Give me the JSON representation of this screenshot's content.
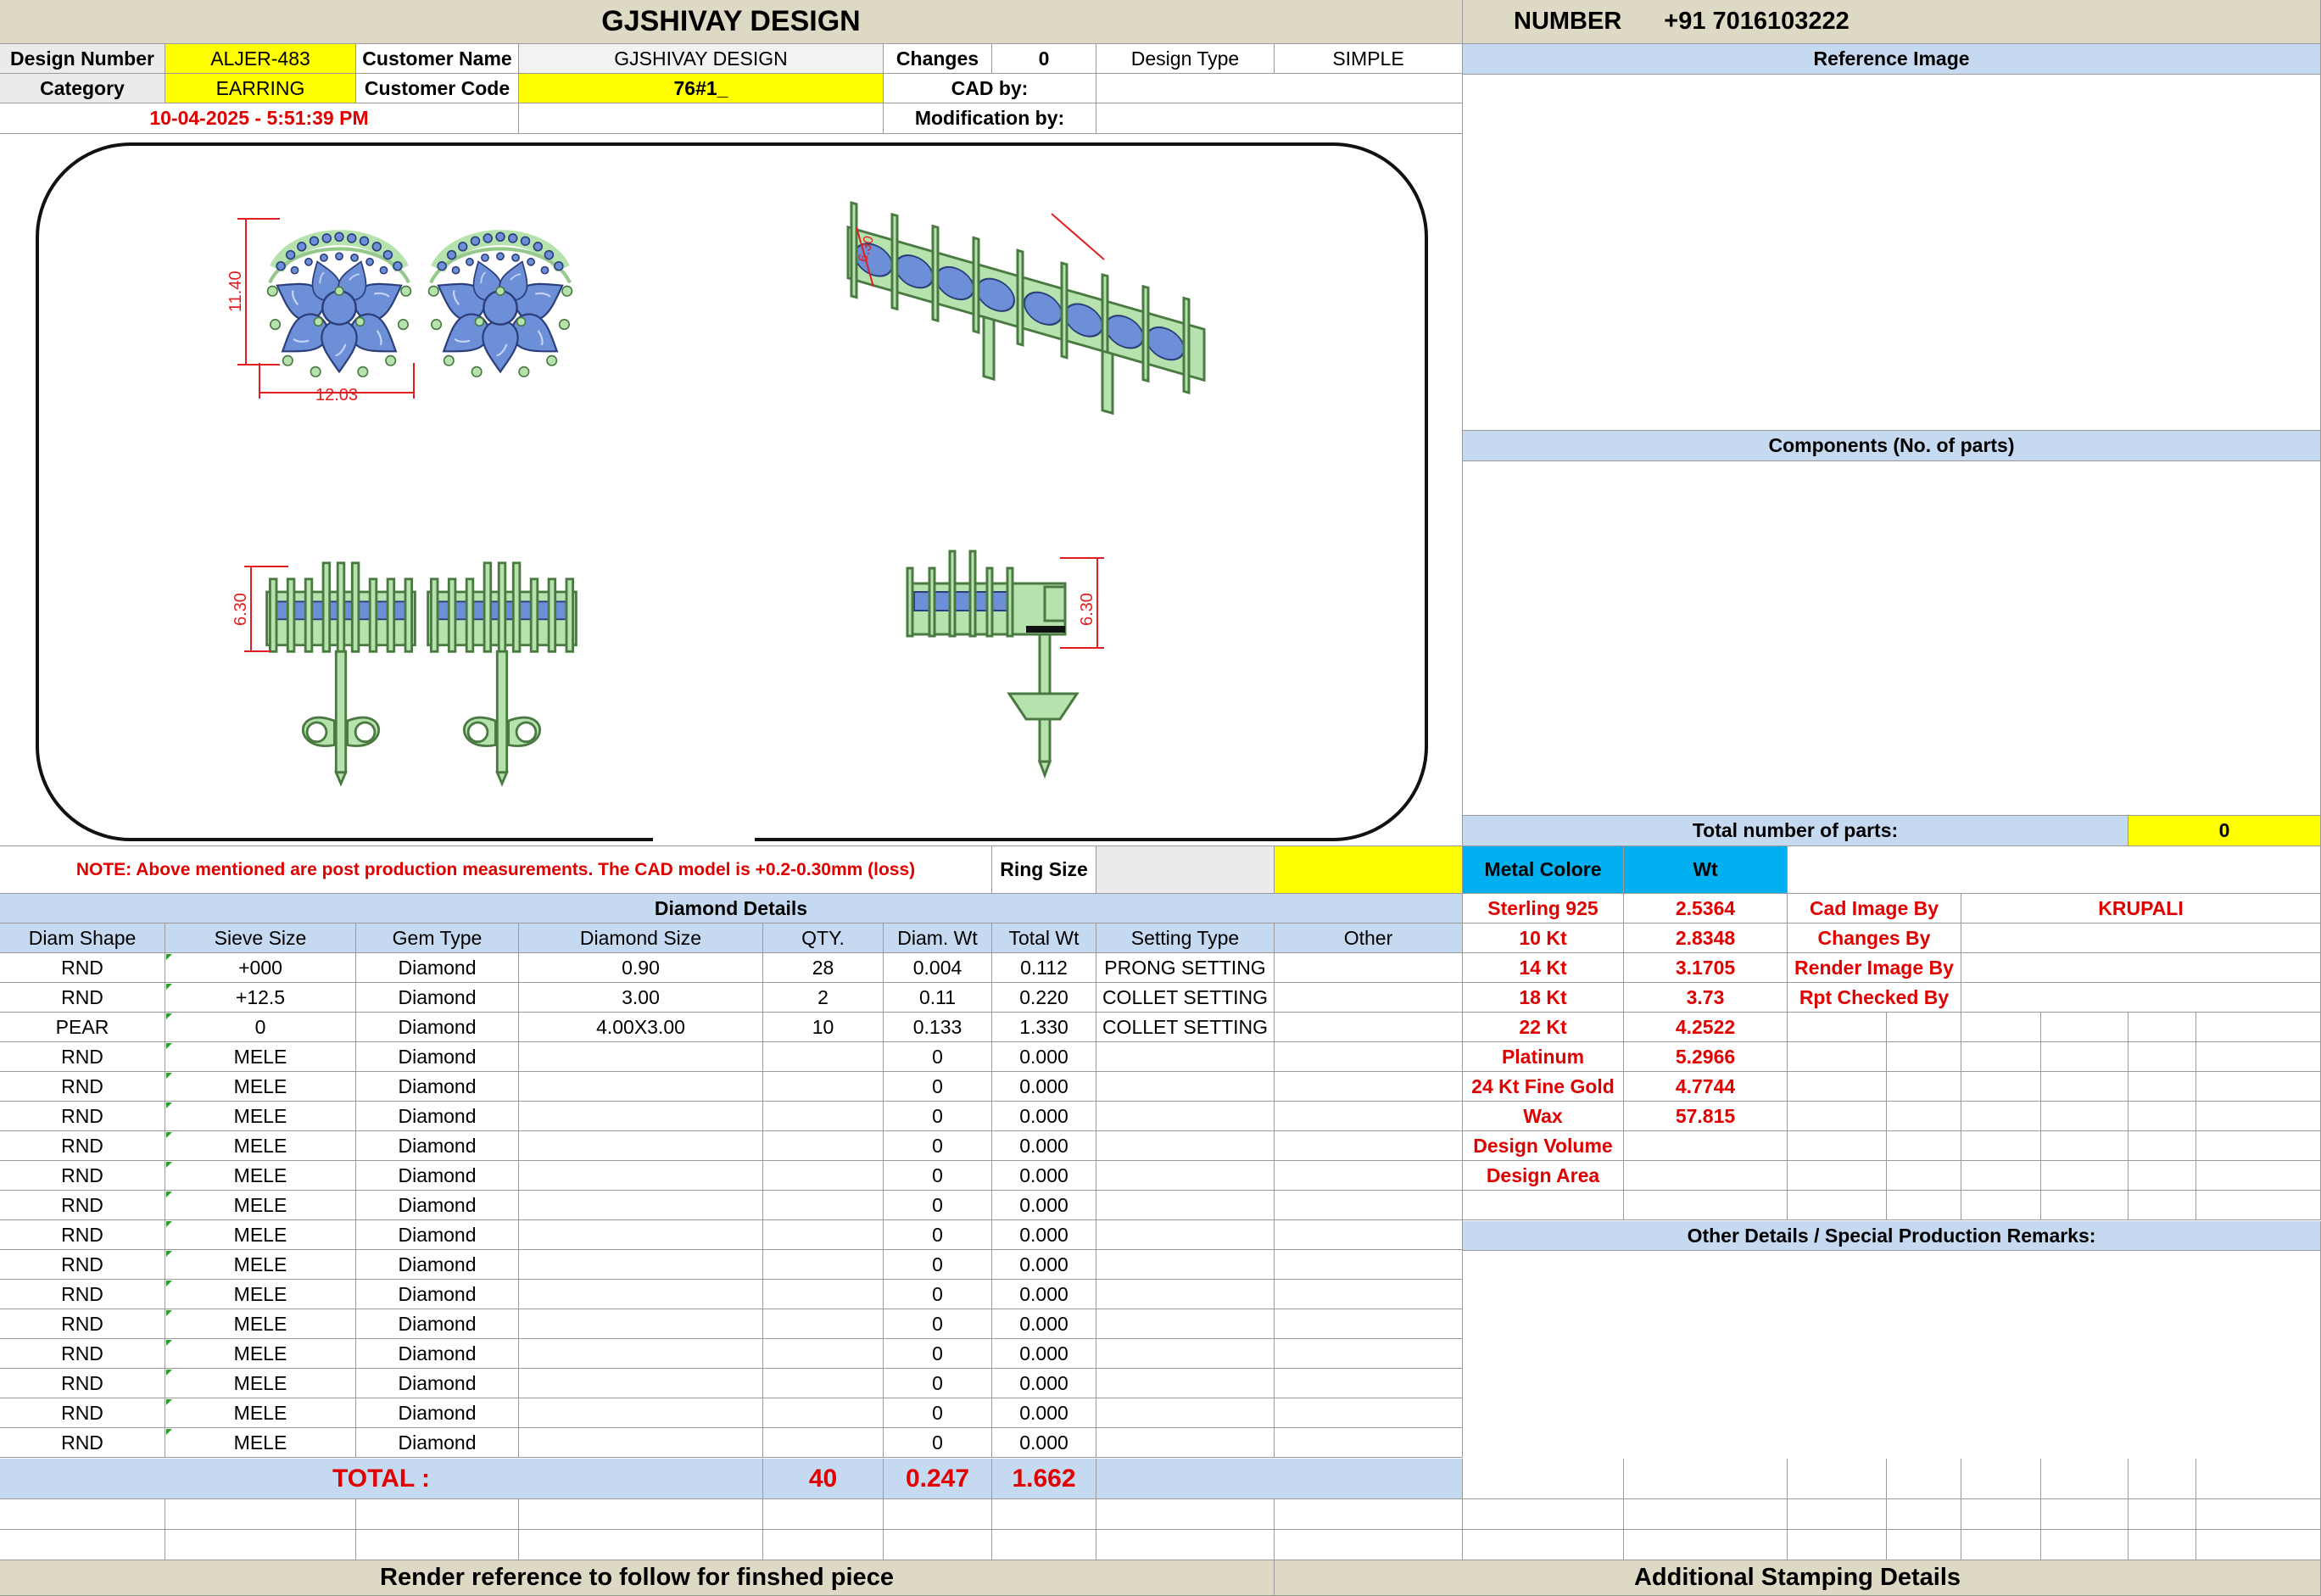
{
  "header": {
    "title": "GJSHIVAY DESIGN",
    "number_label": "NUMBER",
    "number_value": "+91 7016103222"
  },
  "info": {
    "design_number_label": "Design Number",
    "design_number": "ALJER-483",
    "customer_name_label": "Customer Name",
    "customer_name": "GJSHIVAY DESIGN",
    "changes_label": "Changes",
    "changes": "0",
    "design_type_label": "Design Type",
    "design_type": "SIMPLE",
    "category_label": "Category",
    "category": "EARRING",
    "customer_code_label": "Customer Code",
    "customer_code": "76#1_",
    "cad_by_label": "CAD by:",
    "cad_by": "",
    "datetime": "10-04-2025 - 5:51:39 PM",
    "modification_by_label": "Modification by:",
    "modification_by": ""
  },
  "drawing": {
    "dim_front_height": "11.40",
    "dim_front_width": "12.03",
    "dim_iso_small": "6.30",
    "dim_side_height": "6.30",
    "dim_profile_height": "6.30",
    "colors": {
      "metal": "#b6e3ad",
      "stone": "#6d8fd8",
      "dimension": "#e02020"
    }
  },
  "right_panel": {
    "reference_image_title": "Reference Image",
    "components_title": "Components (No. of parts)",
    "total_parts_label": "Total number of parts:",
    "total_parts": "0"
  },
  "note": {
    "text": "NOTE: Above mentioned are post production measurements. The CAD model is +0.2-0.30mm (loss)",
    "ring_size_label": "Ring Size",
    "ring_size": ""
  },
  "metal": {
    "header_label": "Metal Colore",
    "header_wt": "Wt",
    "rows": [
      {
        "name": "Sterling 925",
        "wt": "2.5364"
      },
      {
        "name": "10 Kt",
        "wt": "2.8348"
      },
      {
        "name": "14 Kt",
        "wt": "3.1705"
      },
      {
        "name": "18 Kt",
        "wt": "3.73"
      },
      {
        "name": "22 Kt",
        "wt": "4.2522"
      },
      {
        "name": "Platinum",
        "wt": "5.2966"
      },
      {
        "name": "24 Kt Fine Gold",
        "wt": "4.7744"
      },
      {
        "name": "Wax",
        "wt": "57.815"
      },
      {
        "name": "Design Volume",
        "wt": ""
      },
      {
        "name": "Design Area",
        "wt": ""
      }
    ]
  },
  "credits": [
    {
      "label": "Cad Image By",
      "value": "KRUPALI"
    },
    {
      "label": "Changes By",
      "value": ""
    },
    {
      "label": "Render Image By",
      "value": ""
    },
    {
      "label": "Rpt Checked By",
      "value": ""
    }
  ],
  "diamond": {
    "title": "Diamond Details",
    "columns": [
      "Diam Shape",
      "Sieve Size",
      "Gem Type",
      "Diamond Size",
      "QTY.",
      "Diam. Wt",
      "Total Wt",
      "Setting Type",
      "Other"
    ],
    "rows": [
      [
        "RND",
        "+000",
        "Diamond",
        "0.90",
        "28",
        "0.004",
        "0.112",
        "PRONG SETTING",
        ""
      ],
      [
        "RND",
        "+12.5",
        "Diamond",
        "3.00",
        "2",
        "0.11",
        "0.220",
        "COLLET SETTING",
        ""
      ],
      [
        "PEAR",
        "0",
        "Diamond",
        "4.00X3.00",
        "10",
        "0.133",
        "1.330",
        "COLLET SETTING",
        ""
      ],
      [
        "RND",
        "MELE",
        "Diamond",
        "",
        "",
        "0",
        "0.000",
        "",
        ""
      ],
      [
        "RND",
        "MELE",
        "Diamond",
        "",
        "",
        "0",
        "0.000",
        "",
        ""
      ],
      [
        "RND",
        "MELE",
        "Diamond",
        "",
        "",
        "0",
        "0.000",
        "",
        ""
      ],
      [
        "RND",
        "MELE",
        "Diamond",
        "",
        "",
        "0",
        "0.000",
        "",
        ""
      ],
      [
        "RND",
        "MELE",
        "Diamond",
        "",
        "",
        "0",
        "0.000",
        "",
        ""
      ],
      [
        "RND",
        "MELE",
        "Diamond",
        "",
        "",
        "0",
        "0.000",
        "",
        ""
      ],
      [
        "RND",
        "MELE",
        "Diamond",
        "",
        "",
        "0",
        "0.000",
        "",
        ""
      ],
      [
        "RND",
        "MELE",
        "Diamond",
        "",
        "",
        "0",
        "0.000",
        "",
        ""
      ],
      [
        "RND",
        "MELE",
        "Diamond",
        "",
        "",
        "0",
        "0.000",
        "",
        ""
      ],
      [
        "RND",
        "MELE",
        "Diamond",
        "",
        "",
        "0",
        "0.000",
        "",
        ""
      ],
      [
        "RND",
        "MELE",
        "Diamond",
        "",
        "",
        "0",
        "0.000",
        "",
        ""
      ],
      [
        "RND",
        "MELE",
        "Diamond",
        "",
        "",
        "0",
        "0.000",
        "",
        ""
      ],
      [
        "RND",
        "MELE",
        "Diamond",
        "",
        "",
        "0",
        "0.000",
        "",
        ""
      ],
      [
        "RND",
        "MELE",
        "Diamond",
        "",
        "",
        "0",
        "0.000",
        "",
        ""
      ]
    ],
    "total_label": "TOTAL :",
    "total_qty": "40",
    "total_diam_wt": "0.247",
    "total_wt": "1.662"
  },
  "other_details_title": "Other Details / Special Production Remarks:",
  "footer": {
    "render_reference": "Render reference to follow for finshed piece",
    "stamping": "Additional Stamping Details"
  }
}
